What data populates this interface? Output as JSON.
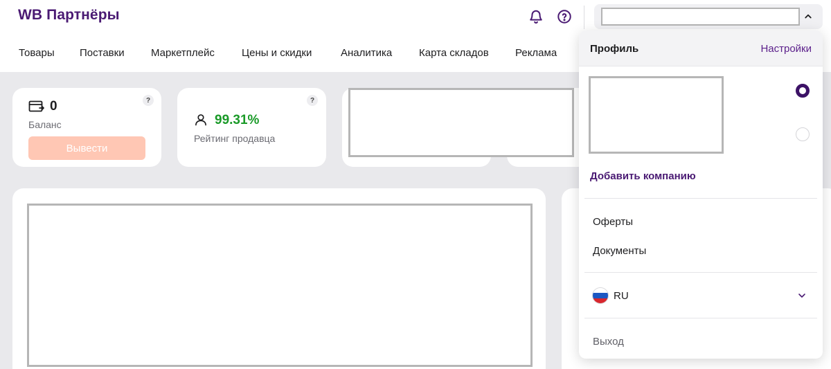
{
  "header": {
    "logo": "WB Партнёры",
    "nav": [
      "Товары",
      "Поставки",
      "Маркетплейс",
      "Цены и скидки",
      "Аналитика",
      "Карта складов",
      "Реклама"
    ]
  },
  "balance_card": {
    "value": "0",
    "label": "Баланс",
    "withdraw_label": "Вывести",
    "help": "?"
  },
  "rating_card": {
    "value": "99.31%",
    "label": "Рейтинг продавца",
    "help": "?"
  },
  "dropdown": {
    "profile_label": "Профиль",
    "settings_label": "Настройки",
    "add_company_label": "Добавить компанию",
    "offers_label": "Оферты",
    "documents_label": "Документы",
    "language_label": "RU",
    "logout_label": "Выход"
  },
  "colors": {
    "brand": "#4a1a73",
    "rating_green": "#1a9a28",
    "withdraw_disabled": "#ffc7b4"
  },
  "icons": [
    "bell-icon",
    "help-circle-icon",
    "chevron-up-icon",
    "wallet-icon",
    "user-icon",
    "chevron-down-icon",
    "russia-flag-icon"
  ]
}
